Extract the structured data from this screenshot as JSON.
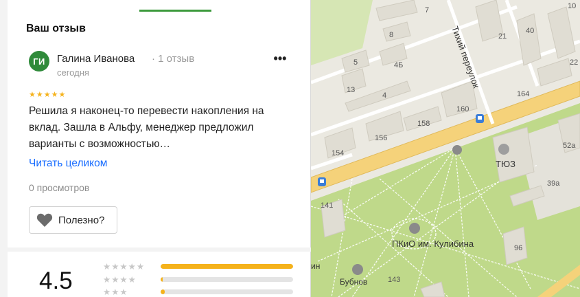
{
  "review_section": {
    "title": "Ваш отзыв",
    "author": {
      "initials": "ГИ",
      "name": "Галина Иванова",
      "review_count": "· 1 отзыв",
      "date": "сегодня"
    },
    "more_icon": "more-horizontal-icon",
    "rating_stars": "★★★★★",
    "text": "Решила я наконец-то перевести накопления на вклад. Зашла в Альфу, менеджер предложил варианты с возможностью…",
    "read_more": "Читать целиком",
    "views": "0 просмотров",
    "useful_button": {
      "icon": "heart-icon",
      "label": "Полезно?"
    }
  },
  "rating_summary": {
    "value": "4.5",
    "distribution": [
      {
        "stars": 5,
        "star_glyphs": "★★★★★",
        "fraction": 1.0
      },
      {
        "stars": 4,
        "star_glyphs": "★★★★",
        "fraction": 0.01
      },
      {
        "stars": 3,
        "star_glyphs": "★★★",
        "fraction": 0.03
      }
    ]
  },
  "map": {
    "street_name": "Тихий переулок",
    "house_numbers": [
      "7",
      "8",
      "10",
      "21",
      "22",
      "40",
      "5",
      "4Б",
      "13",
      "4",
      "164",
      "160",
      "158",
      "156",
      "154",
      "52а",
      "39а",
      "141",
      "143",
      "96"
    ],
    "poi": {
      "theatre": "ТЮЗ",
      "park": "ПКиО им. Кулибина",
      "street_label": "Бубнов",
      "partial_label": "ин"
    },
    "colors": {
      "background": "#ebe9e1",
      "park": "#bfd98a",
      "main_road": "#f5d27a",
      "building": "#e0ddd3"
    }
  },
  "colors": {
    "accent_green": "#3c9a3c",
    "link_blue": "#196dff",
    "star_gold": "#f5b21b"
  }
}
